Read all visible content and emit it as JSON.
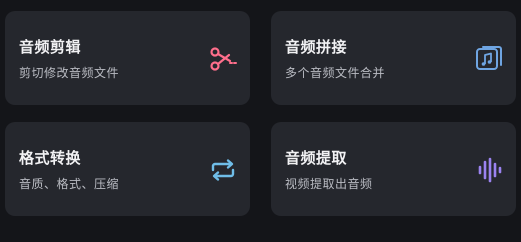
{
  "cards": [
    {
      "title": "音频剪辑",
      "subtitle": "剪切修改音频文件",
      "icon": "scissors-icon",
      "icon_color": "#ff6f8c"
    },
    {
      "title": "音频拼接",
      "subtitle": "多个音频文件合并",
      "icon": "music-files-icon",
      "icon_color": "#6fa5e2"
    },
    {
      "title": "格式转换",
      "subtitle": "音质、格式、压缩",
      "icon": "convert-arrows-icon",
      "icon_color": "#6fbde8"
    },
    {
      "title": "音频提取",
      "subtitle": "视频提取出音频",
      "icon": "waveform-icon",
      "icon_color": "#9b83f0"
    }
  ],
  "colors": {
    "background": "#141519",
    "card": "#25272d",
    "title": "#f2f2f4",
    "subtitle": "#b9bbc2"
  }
}
